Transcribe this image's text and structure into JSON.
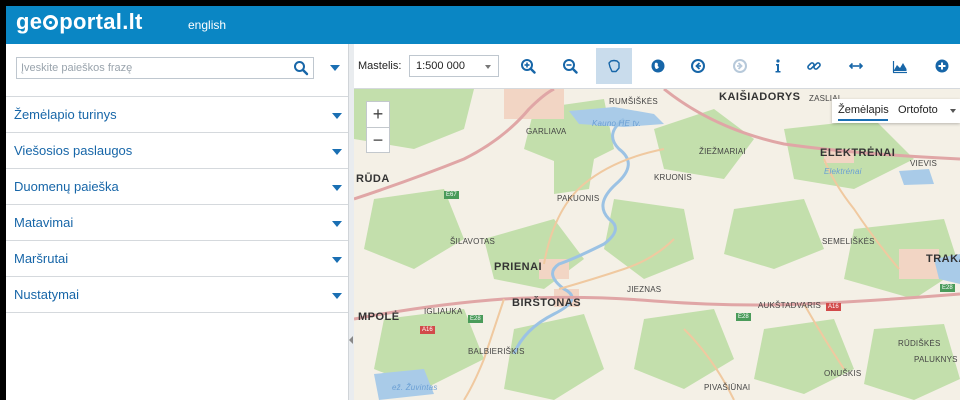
{
  "header": {
    "logo_left": "ge",
    "logo_right": "portal.lt",
    "language_link": "english"
  },
  "sidebar": {
    "search_placeholder": "Įveskite paieškos frazę",
    "menu": [
      {
        "label": "Žemėlapio turinys"
      },
      {
        "label": "Viešosios paslaugos"
      },
      {
        "label": "Duomenų paieška"
      },
      {
        "label": "Matavimai"
      },
      {
        "label": "Maršrutai"
      },
      {
        "label": "Nustatymai"
      }
    ]
  },
  "toolbar": {
    "scale_label": "Mastelis:",
    "scale_value": "1:500 000",
    "tools": [
      {
        "icon": "zoom-in-icon"
      },
      {
        "icon": "zoom-out-icon"
      },
      {
        "icon": "pan-hand-icon",
        "active": true
      },
      {
        "icon": "globe-icon"
      },
      {
        "icon": "back-icon"
      },
      {
        "icon": "forward-icon",
        "disabled": true
      },
      {
        "icon": "info-icon"
      },
      {
        "icon": "link-icon"
      },
      {
        "icon": "measure-distance-icon"
      },
      {
        "icon": "elevation-profile-icon"
      },
      {
        "icon": "add-icon"
      }
    ]
  },
  "map": {
    "zoom_in": "+",
    "zoom_out": "−",
    "basemap_options": [
      "Žemėlapis",
      "Ortofoto"
    ],
    "basemap_selected": "Žemėlapis",
    "places": [
      {
        "name": "KAIŠIADORYS",
        "cls": "big"
      },
      {
        "name": "RUMŠIŠKĖS",
        "cls": ""
      },
      {
        "name": "ZASLIAI",
        "cls": ""
      },
      {
        "name": "GARLIAVA",
        "cls": ""
      },
      {
        "name": "Kauno HE tv.",
        "cls": "water"
      },
      {
        "name": "ŽIEŽMARIAI",
        "cls": ""
      },
      {
        "name": "ELEKTRĖNAI",
        "cls": "big"
      },
      {
        "name": "VIEVIS",
        "cls": ""
      },
      {
        "name": "Elektrėnai",
        "cls": "water"
      },
      {
        "name": "RŪDA",
        "cls": "big"
      },
      {
        "name": "KRUONIS",
        "cls": ""
      },
      {
        "name": "PAKUONIS",
        "cls": ""
      },
      {
        "name": "ŠILAVOTAS",
        "cls": ""
      },
      {
        "name": "SEMELIŠKĖS",
        "cls": ""
      },
      {
        "name": "TRAKAI",
        "cls": "big"
      },
      {
        "name": "PRIENAI",
        "cls": "big"
      },
      {
        "name": "JIEZNAS",
        "cls": ""
      },
      {
        "name": "IGLIAUKA",
        "cls": ""
      },
      {
        "name": "BIRŠTONAS",
        "cls": "big"
      },
      {
        "name": "AUKŠTADVARIS",
        "cls": ""
      },
      {
        "name": "MPOLĖ",
        "cls": "big"
      },
      {
        "name": "BALBIERIŠKIS",
        "cls": ""
      },
      {
        "name": "RŪDIŠKĖS",
        "cls": ""
      },
      {
        "name": "PALUKNYS",
        "cls": ""
      },
      {
        "name": "ONUŠKIS",
        "cls": ""
      },
      {
        "name": "PIVAŠIŪNAI",
        "cls": ""
      },
      {
        "name": "ež. Žuvintas",
        "cls": "water"
      }
    ],
    "road_badges": [
      {
        "label": "E67",
        "color": "green"
      },
      {
        "label": "E28",
        "color": "green"
      },
      {
        "label": "A16",
        "color": "red"
      },
      {
        "label": "E28",
        "color": "green"
      },
      {
        "label": "A16",
        "color": "red"
      },
      {
        "label": "E28",
        "color": "green"
      }
    ]
  },
  "colors": {
    "header_blue": "#0a86c4",
    "link_blue": "#1766a8",
    "active_tool_bg": "#c9dcec",
    "main_road": "#d99a9a",
    "forest": "#bfdca8",
    "water": "#a9cbe8"
  }
}
